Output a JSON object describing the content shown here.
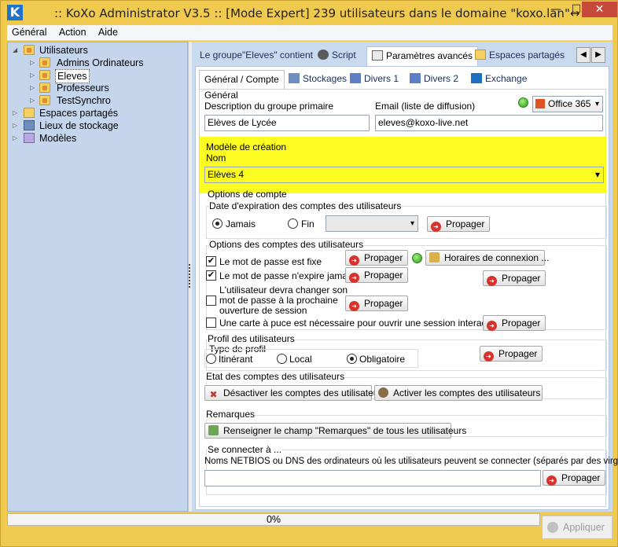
{
  "window": {
    "title": ":: KoXo Administrator V3.5 :: [Mode Expert] 239 utilisateurs dans le domaine \"koxo.lan\"",
    "title_suffix": "↔",
    "min": "—",
    "max": "☐",
    "close": "✕",
    "app_icon": "K"
  },
  "menu": [
    "Général",
    "Action",
    "Aide"
  ],
  "tree": {
    "root": "Utilisateurs",
    "children": [
      "Admins Ordinateurs",
      "Eleves",
      "Professeurs",
      "TestSynchro"
    ],
    "selected": "Eleves",
    "others": [
      "Espaces partagés",
      "Lieux de stockage",
      "Modèles"
    ]
  },
  "tabs": [
    {
      "label": "Le groupe\"Eleves\" contient",
      "active": false
    },
    {
      "label": "Script",
      "active": false
    },
    {
      "label": "Paramètres avancés",
      "active": true
    },
    {
      "label": "Espaces partagés",
      "active": false
    }
  ],
  "subtabs": [
    {
      "label": "Général / Compte",
      "active": true
    },
    {
      "label": "Stockages"
    },
    {
      "label": "Divers 1"
    },
    {
      "label": "Divers 2"
    },
    {
      "label": "Exchange"
    }
  ],
  "general": {
    "section": "Général",
    "description_label": "Description du groupe primaire",
    "description_value": "Elèves de Lycée",
    "email_label": "Email (liste de diffusion)",
    "email_value": "eleves@koxo-live.net",
    "office_select": "Office 365"
  },
  "model": {
    "section": "Modèle de création",
    "name_label": "Nom",
    "name_value": "Elèves 4"
  },
  "account_options": {
    "section": "Options de compte",
    "expiration_label": "Date d'expiration des comptes des utilisateurs",
    "never": "Jamais",
    "end": "Fin",
    "propagate": "Propager"
  },
  "user_options": {
    "section": "Options des comptes des utilisateurs",
    "fixed_password": "Le mot de passe est fixe",
    "never_expire": "Le mot de passe n'expire jamais",
    "must_change": [
      "L'utilisateur devra changer son",
      "mot de passe à la prochaine",
      "ouverture de session"
    ],
    "smartcard": "Une carte à puce est nécessaire pour ouvrir une session interactive",
    "logon_hours": "Horaires de connexion ...",
    "propagate": "Propager"
  },
  "profile": {
    "section": "Profil des utilisateurs",
    "type_label": "Type de profil",
    "roaming": "Itinérant",
    "local": "Local",
    "mandatory": "Obligatoire",
    "propagate": "Propager"
  },
  "state": {
    "section": "Etat des comptes des utilisateurs",
    "disable": "Désactiver les comptes des utilisateurs",
    "enable": "Activer les comptes des utilisateurs"
  },
  "remarks": {
    "section": "Remarques",
    "fill": "Renseigner le champ \"Remarques\" de tous les utilisateurs"
  },
  "connect": {
    "section": "Se connecter à ...",
    "label": "Noms NETBIOS ou DNS des ordinateurs où les utilisateurs peuvent se connecter (séparés par des virgules)",
    "propagate": "Propager"
  },
  "footer": {
    "progress": "0%",
    "apply": "Appliquer"
  },
  "colors": {
    "highlight": "#fcfb22",
    "frame": "#f0c94f",
    "panel": "#c9d9ee"
  }
}
